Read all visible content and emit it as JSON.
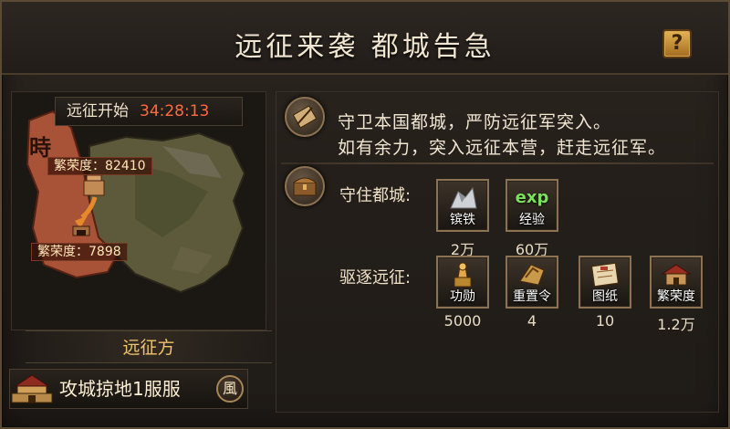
{
  "title": "远征来袭 都城告急",
  "help_label": "?",
  "timer": {
    "label": "远征开始",
    "value": "34:28:13"
  },
  "map": {
    "badge_char": "時",
    "top_prosperity": "繁荣度：82410",
    "bottom_prosperity": "繁荣度：7898",
    "colors": {
      "enemy_region": "#b4573a",
      "land": "#5d5a3c"
    }
  },
  "side_label": "远征方",
  "server": {
    "name": "攻城掠地1服服",
    "badge": "風"
  },
  "intro": {
    "line1": "守卫本国都城，严防远征军突入。",
    "line2": "如有余力，突入远征本营，赶走远征军。"
  },
  "defend": {
    "label": "守住都城:",
    "rewards": [
      {
        "name": "镔铁",
        "count": "2万",
        "icon": "iron-icon"
      },
      {
        "name": "经验",
        "count": "60万",
        "icon": "exp-icon",
        "exp_text": "exp"
      }
    ]
  },
  "expel": {
    "label": "驱逐远征:",
    "rewards": [
      {
        "name": "功勋",
        "count": "5000",
        "icon": "merit-icon"
      },
      {
        "name": "重置令",
        "count": "4",
        "icon": "reset-token-icon"
      },
      {
        "name": "图纸",
        "count": "10",
        "icon": "blueprint-icon"
      },
      {
        "name": "繁荣度",
        "count": "1.2万",
        "icon": "prosperity-icon"
      }
    ]
  }
}
